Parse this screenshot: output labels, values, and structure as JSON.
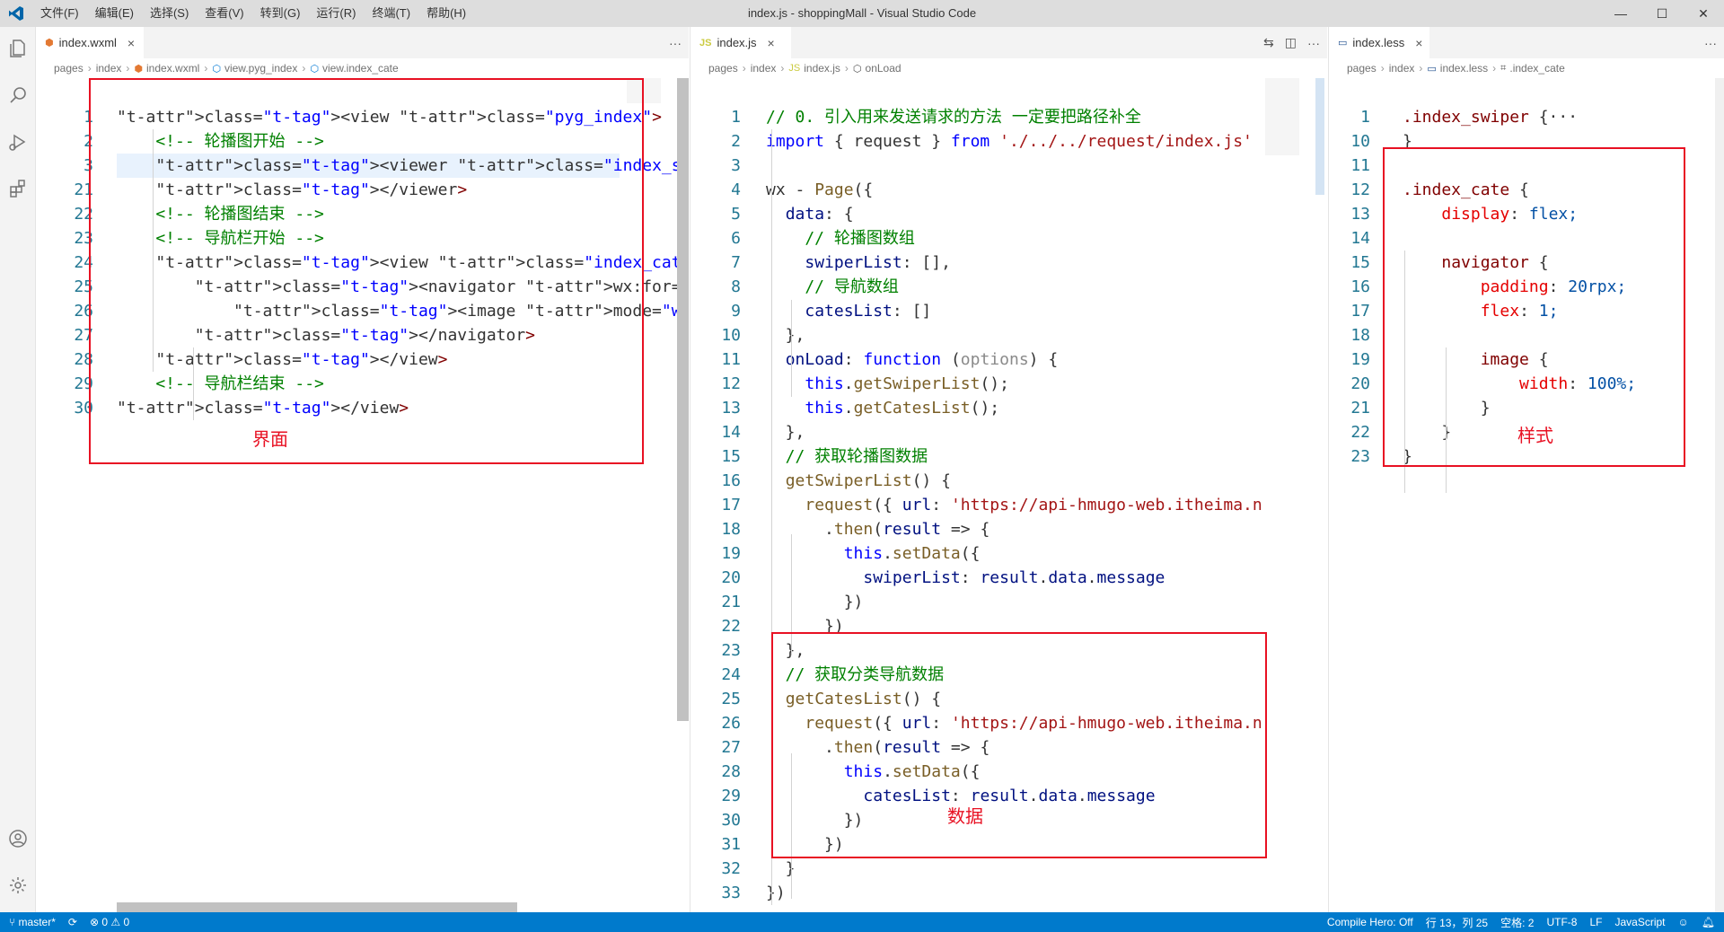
{
  "window": {
    "title": "index.js - shoppingMall - Visual Studio Code",
    "menu": [
      "文件(F)",
      "编辑(E)",
      "选择(S)",
      "查看(V)",
      "转到(G)",
      "运行(R)",
      "终端(T)",
      "帮助(H)"
    ],
    "controls": {
      "minimize": "—",
      "maximize": "☐",
      "close": "✕"
    }
  },
  "activity_bar": {
    "icons": [
      "explorer-icon",
      "search-icon",
      "run-debug-icon",
      "extensions-icon",
      "account-icon",
      "settings-gear-icon"
    ]
  },
  "editors": {
    "left": {
      "tab": "index.wxml",
      "close": "×",
      "more": "···",
      "breadcrumb": [
        "pages",
        "index",
        "index.wxml",
        "view.pyg_index",
        "view.index_cate"
      ],
      "annotation": "界面"
    },
    "middle": {
      "tab": "index.js",
      "tab_icon": "JS",
      "close": "×",
      "more": "···",
      "breadcrumb": [
        "pages",
        "index",
        "index.js",
        "onLoad"
      ],
      "annotation": "数据"
    },
    "right": {
      "tab": "index.less",
      "close": "×",
      "more": "···",
      "breadcrumb": [
        "pages",
        "index",
        "index.less",
        ".index_cate"
      ],
      "annotation": "样式"
    }
  },
  "wxml_lines": [
    {
      "n": "1",
      "t": "<view class=\"pyg_index\">"
    },
    {
      "n": "2",
      "t": "    <!-- 轮播图开始 -->"
    },
    {
      "n": "3",
      "t": "    <viewer class=\"index_swiper\">···"
    },
    {
      "n": "21",
      "t": "    </viewer>"
    },
    {
      "n": "22",
      "t": "    <!-- 轮播图结束 -->"
    },
    {
      "n": "23",
      "t": "    <!-- 导航栏开始 -->"
    },
    {
      "n": "24",
      "t": "    <view class=\"index_cate\">"
    },
    {
      "n": "25",
      "t": "        <navigator wx:for=\"{{catesList}}\" wx:key=\"na"
    },
    {
      "n": "26",
      "t": "            <image mode=\"widthFix\" src=\"{{item.image"
    },
    {
      "n": "27",
      "t": "        </navigator>"
    },
    {
      "n": "28",
      "t": "    </view>"
    },
    {
      "n": "29",
      "t": "    <!-- 导航栏结束 -->"
    },
    {
      "n": "30",
      "t": "</view>"
    }
  ],
  "js_lines": [
    {
      "n": "1",
      "t": "// 0. 引入用来发送请求的方法 一定要把路径补全"
    },
    {
      "n": "2",
      "t": "import { request } from './../../request/index.js'"
    },
    {
      "n": "3",
      "t": ""
    },
    {
      "n": "4",
      "t": "wx - Page({"
    },
    {
      "n": "5",
      "t": "  data: {"
    },
    {
      "n": "6",
      "t": "    // 轮播图数组"
    },
    {
      "n": "7",
      "t": "    swiperList: [],"
    },
    {
      "n": "8",
      "t": "    // 导航数组"
    },
    {
      "n": "9",
      "t": "    catesList: []"
    },
    {
      "n": "10",
      "t": "  },"
    },
    {
      "n": "11",
      "t": "  onLoad: function (options) {"
    },
    {
      "n": "12",
      "t": "    this.getSwiperList();"
    },
    {
      "n": "13",
      "t": "    this.getCatesList();"
    },
    {
      "n": "14",
      "t": "  },"
    },
    {
      "n": "15",
      "t": "  // 获取轮播图数据"
    },
    {
      "n": "16",
      "t": "  getSwiperList() {"
    },
    {
      "n": "17",
      "t": "    request({ url: 'https://api-hmugo-web.itheima.n"
    },
    {
      "n": "18",
      "t": "      .then(result => {"
    },
    {
      "n": "19",
      "t": "        this.setData({"
    },
    {
      "n": "20",
      "t": "          swiperList: result.data.message"
    },
    {
      "n": "21",
      "t": "        })"
    },
    {
      "n": "22",
      "t": "      })"
    },
    {
      "n": "23",
      "t": "  },"
    },
    {
      "n": "24",
      "t": "  // 获取分类导航数据"
    },
    {
      "n": "25",
      "t": "  getCatesList() {"
    },
    {
      "n": "26",
      "t": "    request({ url: 'https://api-hmugo-web.itheima.n"
    },
    {
      "n": "27",
      "t": "      .then(result => {"
    },
    {
      "n": "28",
      "t": "        this.setData({"
    },
    {
      "n": "29",
      "t": "          catesList: result.data.message"
    },
    {
      "n": "30",
      "t": "        })"
    },
    {
      "n": "31",
      "t": "      })"
    },
    {
      "n": "32",
      "t": "  }"
    },
    {
      "n": "33",
      "t": "})"
    }
  ],
  "less_lines": [
    {
      "n": "1",
      "t": ".index_swiper {···"
    },
    {
      "n": "10",
      "t": "}"
    },
    {
      "n": "11",
      "t": ""
    },
    {
      "n": "12",
      "t": ".index_cate {"
    },
    {
      "n": "13",
      "t": "    display: flex;"
    },
    {
      "n": "14",
      "t": ""
    },
    {
      "n": "15",
      "t": "    navigator {"
    },
    {
      "n": "16",
      "t": "        padding: 20rpx;"
    },
    {
      "n": "17",
      "t": "        flex: 1;"
    },
    {
      "n": "18",
      "t": ""
    },
    {
      "n": "19",
      "t": "        image {"
    },
    {
      "n": "20",
      "t": "            width: 100%;"
    },
    {
      "n": "21",
      "t": "        }"
    },
    {
      "n": "22",
      "t": "    }"
    },
    {
      "n": "23",
      "t": "}"
    }
  ],
  "status": {
    "branch": "master*",
    "sync": "⟳",
    "problems": "⊗ 0 ⚠ 0",
    "compile_hero": "Compile Hero: Off",
    "position": "行 13，列 25",
    "spaces": "空格: 2",
    "encoding": "UTF-8",
    "eol": "LF",
    "language": "JavaScript"
  }
}
